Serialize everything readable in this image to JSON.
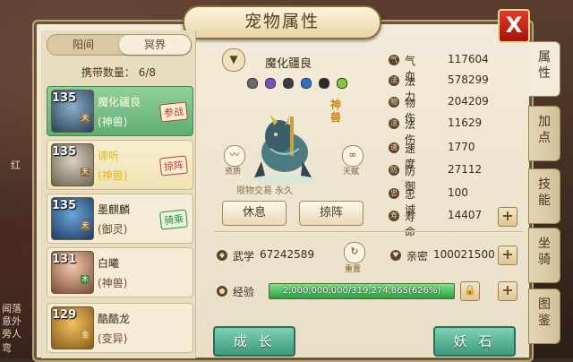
{
  "window": {
    "title": "宠物属性",
    "close_label": "X"
  },
  "realm_tabs": [
    {
      "label": "阳间",
      "active": false
    },
    {
      "label": "冥界",
      "active": true
    }
  ],
  "carry": {
    "label": "携带数量： 6/8"
  },
  "pets": [
    {
      "level": "135",
      "stage": "天",
      "name": "魔化疆良",
      "type": "(神兽)",
      "stamp": "参战",
      "stamp_color": "#c0392b",
      "selected": true
    },
    {
      "level": "135",
      "stage": "天",
      "name": "谛听",
      "type": "(神兽)",
      "stamp": "掠阵",
      "stamp_color": "#c0392b",
      "selected": false
    },
    {
      "level": "135",
      "stage": "天",
      "name": "墨麒麟",
      "type": "(御灵)",
      "stamp": "骑乘",
      "stamp_color": "#2e8b3f",
      "selected": false
    },
    {
      "level": "131",
      "stage": "木",
      "name": "白曦",
      "type": "(神兽)",
      "stamp": "",
      "stamp_color": "",
      "selected": false
    },
    {
      "level": "129",
      "stage": "金",
      "name": "酷酷龙",
      "type": "(变异)",
      "stamp": "",
      "stamp_color": "",
      "selected": false
    }
  ],
  "selected_pet": {
    "name": "魔化疆良",
    "tag": "神兽",
    "tradable_note": "限物交易 永久",
    "left_icon_label": "资质",
    "right_icon_label": "天赋"
  },
  "actions": {
    "rest": "休息",
    "assist": "掠阵"
  },
  "stats": [
    {
      "icon": "气",
      "label": "气血",
      "value": "117604"
    },
    {
      "icon": "法",
      "label": "法力",
      "value": "578299"
    },
    {
      "icon": "物",
      "label": "物伤",
      "value": "204209"
    },
    {
      "icon": "法",
      "label": "法伤",
      "value": "11629"
    },
    {
      "icon": "速",
      "label": "速度",
      "value": "1770"
    },
    {
      "icon": "防",
      "label": "防御",
      "value": "27112"
    },
    {
      "icon": "忠",
      "label": "忠诚",
      "value": "100"
    },
    {
      "icon": "寿",
      "label": "寿命",
      "value": "14407"
    }
  ],
  "martial": {
    "label": "武学",
    "value": "67242589",
    "reset_label": "重置"
  },
  "intimacy": {
    "label": "亲密",
    "value": "100021500"
  },
  "experience": {
    "label": "经验",
    "text": "2,000,000,000/319,274,865(626%)",
    "fill_fraction": 1.0
  },
  "bottom_buttons": {
    "grow": "成 长",
    "demon_stone": "妖 石"
  },
  "side_tabs": [
    {
      "label": "属性",
      "active": true
    },
    {
      "label": "加点",
      "active": false
    },
    {
      "label": "技能",
      "active": false
    },
    {
      "label": "坐骑",
      "active": false
    },
    {
      "label": "图鉴",
      "active": false
    }
  ],
  "background_text": [
    "红",
    "闻落",
    "意外",
    "旁人",
    "弯"
  ],
  "colors": {
    "selected_card": "#6fbf80",
    "exp_fill": "#2aa040",
    "close": "#c0241a",
    "bottom_button": "#4aa785"
  }
}
